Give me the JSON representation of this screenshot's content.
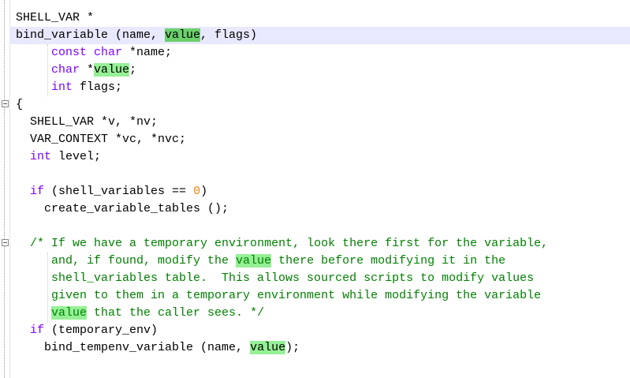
{
  "editor": {
    "lines": [
      [
        {
          "t": "SHELL_VAR *"
        }
      ],
      [
        {
          "t": "bind_variable (name, "
        },
        {
          "t": "value",
          "c": "hl-sel"
        },
        {
          "t": ", flags)"
        }
      ],
      [
        {
          "t": "     "
        },
        {
          "t": "const char",
          "c": "kw"
        },
        {
          "t": " *name;"
        }
      ],
      [
        {
          "t": "     "
        },
        {
          "t": "char",
          "c": "kw"
        },
        {
          "t": " *"
        },
        {
          "t": "value",
          "c": "hl"
        },
        {
          "t": ";"
        }
      ],
      [
        {
          "t": "     "
        },
        {
          "t": "int",
          "c": "kw"
        },
        {
          "t": " flags;"
        }
      ],
      [
        {
          "t": "{"
        }
      ],
      [
        {
          "t": "  SHELL_VAR *v, *nv;"
        }
      ],
      [
        {
          "t": "  VAR_CONTEXT *vc, *nvc;"
        }
      ],
      [
        {
          "t": "  "
        },
        {
          "t": "int",
          "c": "kw"
        },
        {
          "t": " level;"
        }
      ],
      [
        {
          "t": ""
        }
      ],
      [
        {
          "t": "  "
        },
        {
          "t": "if",
          "c": "kw"
        },
        {
          "t": " (shell_variables == "
        },
        {
          "t": "0",
          "c": "num"
        },
        {
          "t": ")"
        }
      ],
      [
        {
          "t": "    create_variable_tables ();"
        }
      ],
      [
        {
          "t": ""
        }
      ],
      [
        {
          "t": "  "
        },
        {
          "t": "/* If we have a temporary environment, look there first for the variable,",
          "c": "cm"
        }
      ],
      [
        {
          "t": "     and, if found, modify the ",
          "c": "cm"
        },
        {
          "t": "value",
          "c": "cm hl"
        },
        {
          "t": " there before modifying it in the",
          "c": "cm"
        }
      ],
      [
        {
          "t": "     shell_variables table.  This allows sourced scripts to modify values",
          "c": "cm"
        }
      ],
      [
        {
          "t": "     given to them in a temporary environment while modifying the variable",
          "c": "cm"
        }
      ],
      [
        {
          "t": "     ",
          "c": "cm"
        },
        {
          "t": "value",
          "c": "cm hl"
        },
        {
          "t": " that the caller sees. */",
          "c": "cm"
        }
      ],
      [
        {
          "t": "  "
        },
        {
          "t": "if",
          "c": "kw"
        },
        {
          "t": " (temporary_env)"
        }
      ],
      [
        {
          "t": "    bind_tempenv_variable (name, "
        },
        {
          "t": "value",
          "c": "hl"
        },
        {
          "t": ");"
        }
      ]
    ],
    "current_line": 1,
    "colors": {
      "keyword": "#8000ff",
      "number": "#ff8000",
      "comment": "#008000",
      "highlight": "#95f095",
      "selected_highlight": "#6cd06c",
      "current_line": "#e8e8ff"
    }
  }
}
